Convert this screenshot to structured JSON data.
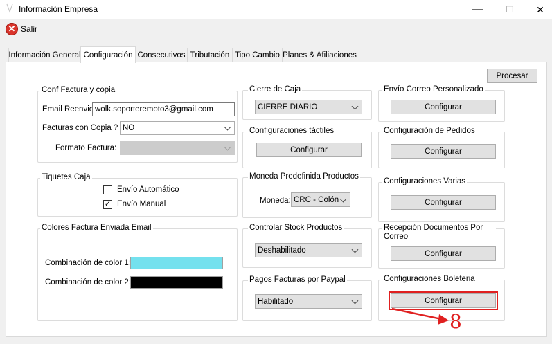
{
  "window": {
    "title": "Información Empresa",
    "minimize_glyph": "—",
    "maximize_glyph": "☐",
    "close_glyph": "✕"
  },
  "menu": {
    "exit_label": "Salir",
    "exit_icon": "close-circle-icon"
  },
  "tabs": [
    {
      "label": "Información General"
    },
    {
      "label": "Configuración"
    },
    {
      "label": "Consecutivos"
    },
    {
      "label": "Tributación"
    },
    {
      "label": "Tipo Cambio"
    },
    {
      "label": "Planes & Afiliaciones"
    }
  ],
  "procesar_label": "Procesar",
  "conf_factura": {
    "title": "Conf Factura y copia",
    "email_label": "Email Reenvio:",
    "email_value": "wolk.soporteremoto3@gmail.com",
    "copias_label": "Facturas con Copia ?",
    "copias_value": "NO",
    "formato_label": "Formato Factura:",
    "formato_value": ""
  },
  "tiquetes": {
    "title": "Tiquetes Caja",
    "auto_label": "Envío Automático",
    "auto_checked": false,
    "manual_label": "Envío Manual",
    "manual_checked": true,
    "check_glyph": "✓"
  },
  "colores": {
    "title": "Colores Factura Enviada Email",
    "color1_label": "Combinación de color 1:",
    "color1": "#74e1ee",
    "color2_label": "Combinación de color 2:",
    "color2": "#000000"
  },
  "cierre_caja": {
    "title": "Cierre de Caja",
    "value": "CIERRE DIARIO"
  },
  "tactiles": {
    "title": "Configuraciones táctiles",
    "button": "Configurar"
  },
  "moneda": {
    "title": "Moneda Predefinida Productos",
    "label": "Moneda:",
    "value": "CRC - Colón"
  },
  "stock": {
    "title": "Controlar Stock Productos",
    "value": "Deshabilitado"
  },
  "paypal": {
    "title": "Pagos Facturas por Paypal",
    "value": "Habilitado"
  },
  "correo": {
    "title": "Envío Correo Personalizado",
    "button": "Configurar"
  },
  "pedidos": {
    "title": "Configuración de Pedidos",
    "button": "Configurar"
  },
  "varias": {
    "title": "Configuraciones Varias",
    "button": "Configurar"
  },
  "recepcion": {
    "title": "Recepción Documentos Por Correo",
    "button": "Configurar"
  },
  "boleteria": {
    "title": "Configuraciones Boleteria",
    "button": "Configurar"
  },
  "annotation": {
    "text": "8",
    "color": "#e02020"
  }
}
